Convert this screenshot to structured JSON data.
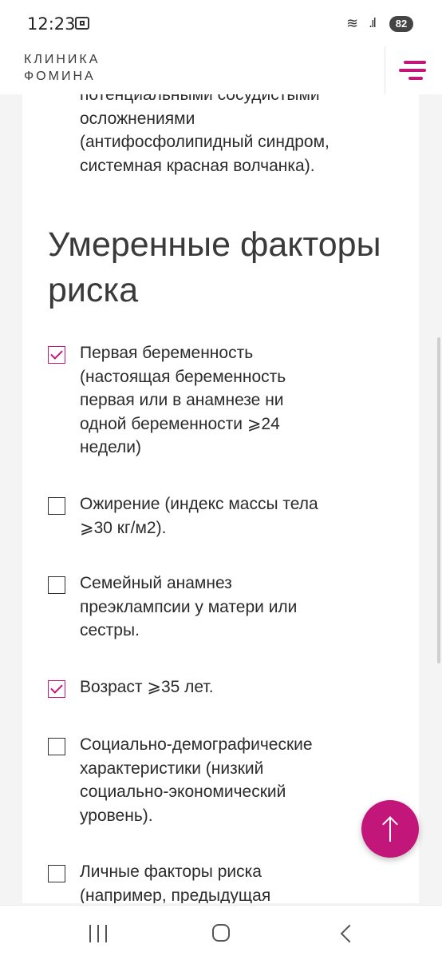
{
  "status_bar": {
    "time": "12:23",
    "wifi_icon": "wifi-icon",
    "signal_icon": "signal-icon",
    "battery": "82"
  },
  "header": {
    "logo_line1": "КЛИНИКА",
    "logo_line2": "ФОМИНА",
    "menu_icon": "hamburger-menu-icon",
    "accent_color": "#c3167a"
  },
  "content": {
    "partial_text_lines": [
      "потенциальными сосудистыми",
      "осложнениями",
      "(антифосфолипидный синдром,",
      "системная красная волчанка)."
    ],
    "section_title": "Умеренные факторы риска",
    "risk_factors": [
      {
        "checked": true,
        "lines": [
          "Первая беременность",
          "(настоящая беременность",
          "первая или в анамнезе ни",
          "одной беременности ⩾24",
          "недели)"
        ]
      },
      {
        "checked": false,
        "lines": [
          "Ожирение (индекс массы тела",
          "⩾30 кг/м2)."
        ]
      },
      {
        "checked": false,
        "lines": [
          "Семейный анамнез",
          "преэклампсии у матери или",
          "сестры."
        ]
      },
      {
        "checked": true,
        "lines": [
          "Возраст ⩾35 лет."
        ]
      },
      {
        "checked": false,
        "lines": [
          "Социально-демографические",
          "характеристики (низкий",
          "социально-экономический",
          "уровень)."
        ]
      },
      {
        "checked": false,
        "lines": [
          "Личные факторы риска",
          "(например, предыдущая"
        ]
      }
    ]
  },
  "scroll_top_icon": "arrow-up-icon",
  "nav_bar": {
    "recent_icon": "recent-apps-icon",
    "home_icon": "home-icon",
    "back_icon": "back-icon"
  }
}
